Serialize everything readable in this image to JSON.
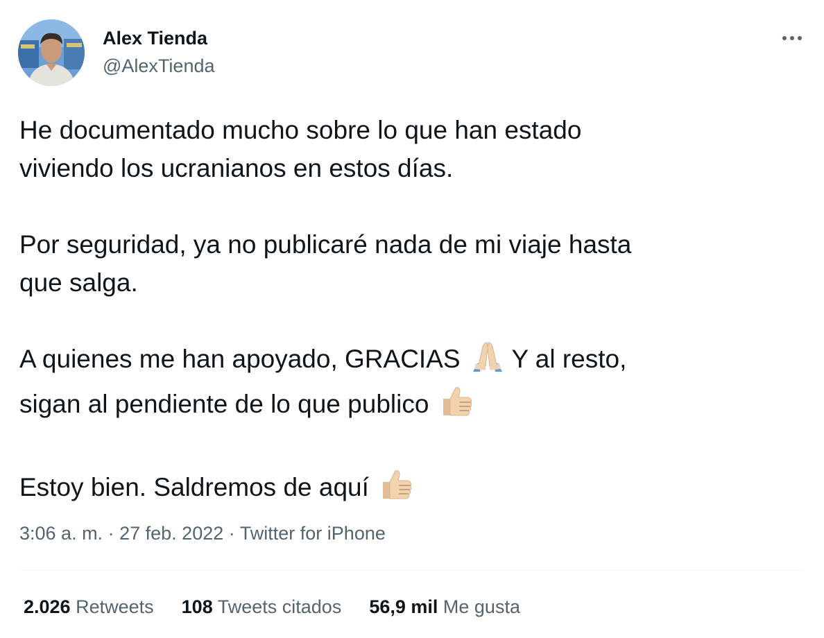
{
  "user": {
    "name": "Alex Tienda",
    "handle": "@AlexTienda"
  },
  "tweet": {
    "paragraphs": [
      {
        "lines": [
          "He documentado mucho sobre lo que han estado",
          "viviendo los ucranianos en estos días."
        ]
      },
      {
        "lines": [
          "Por seguridad, ya no publicaré nada de mi viaje hasta",
          "que salga."
        ]
      },
      {
        "lines": [
          "A quienes me han apoyado, GRACIAS",
          "Y al resto,",
          "sigan al pendiente de lo que publico"
        ]
      },
      {
        "lines": [
          "Estoy bien. Saldremos de aquí"
        ]
      }
    ],
    "emojis": [
      "folded-hands-icon",
      "thumbs-up-icon",
      "thumbs-up-icon"
    ]
  },
  "meta": {
    "time": "3:06 a. m.",
    "separator": "·",
    "date": "27 feb. 2022",
    "source": "Twitter for iPhone"
  },
  "stats": [
    {
      "count": "2.026",
      "label": "Retweets"
    },
    {
      "count": "108",
      "label": "Tweets citados"
    },
    {
      "count": "56,9 mil",
      "label": "Me gusta"
    }
  ],
  "colors": {
    "text": "#0f1419",
    "secondary": "#536471",
    "divider": "#eff3f4",
    "skin_tone": "#f1d3b0"
  }
}
